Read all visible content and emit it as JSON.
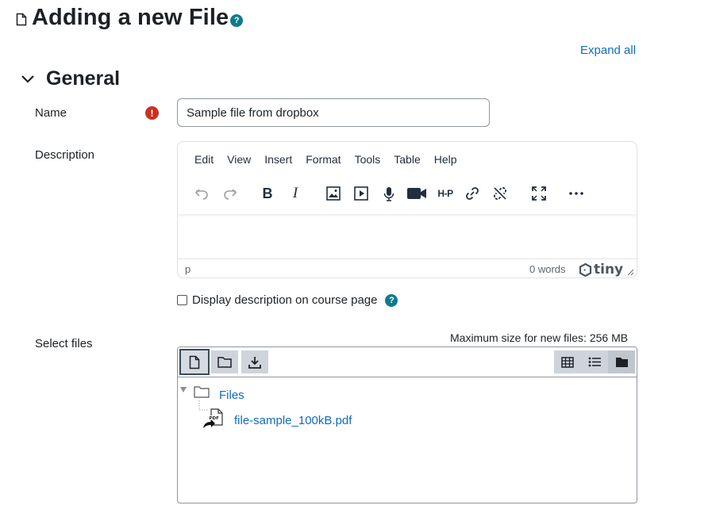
{
  "page": {
    "title": "Adding a new File",
    "help_symbol": "?"
  },
  "actions": {
    "expand_all": "Expand all"
  },
  "section": {
    "title": "General"
  },
  "fields": {
    "name_label": "Name",
    "required_symbol": "!",
    "name_value": "Sample file from dropbox",
    "description_label": "Description",
    "select_files_label": "Select files"
  },
  "editor": {
    "menu": [
      "Edit",
      "View",
      "Insert",
      "Format",
      "Tools",
      "Table",
      "Help"
    ],
    "toolbar_icons": [
      "undo-icon",
      "redo-icon",
      "bold-icon",
      "italic-icon",
      "image-icon",
      "media-icon",
      "microphone-icon",
      "video-camera-icon",
      "h5p-icon",
      "link-icon",
      "unlink-icon",
      "fullscreen-icon",
      "more-icon"
    ],
    "bold_glyph": "B",
    "italic_glyph": "I",
    "h5p_text": "H-P",
    "status_element": "p",
    "word_count": "0 words",
    "brand": "tiny"
  },
  "display_description": {
    "label": "Display description on course page",
    "checked": false
  },
  "filemanager": {
    "max_size_text": "Maximum size for new files: 256 MB",
    "buttons": [
      "add-file-icon",
      "create-folder-icon",
      "download-icon"
    ],
    "view_buttons": [
      "icons-view-icon",
      "list-view-icon",
      "tree-view-icon"
    ],
    "root_folder": "Files",
    "files": [
      {
        "name": "file-sample_100kB.pdf",
        "icon": "pdf-alias-icon",
        "pdf_tag": "PDF"
      }
    ]
  },
  "colors": {
    "link": "#0f6cbf",
    "required": "#ca3120",
    "help_teal": "#0f7b8a",
    "text": "#1d2125"
  }
}
